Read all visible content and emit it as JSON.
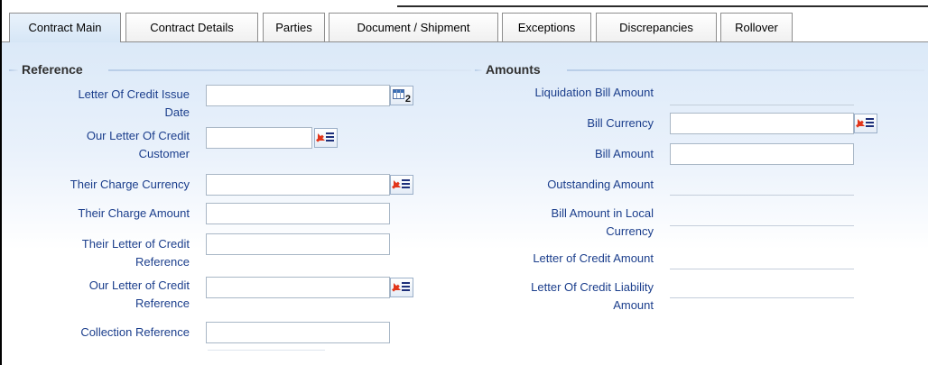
{
  "tabs": [
    {
      "label": "Contract Main",
      "active": true
    },
    {
      "label": "Contract Details",
      "active": false
    },
    {
      "label": "Parties",
      "active": false
    },
    {
      "label": "Document / Shipment",
      "active": false
    },
    {
      "label": "Exceptions",
      "active": false
    },
    {
      "label": "Discrepancies",
      "active": false
    },
    {
      "label": "Rollover",
      "active": false
    }
  ],
  "reference": {
    "title": "Reference",
    "fields": {
      "lc_issue_date": {
        "label_line1": "Letter Of Credit Issue",
        "label_line2": "Date",
        "value": "",
        "icon": "calendar-icon",
        "icon_badge": "2"
      },
      "our_lc_customer": {
        "label_line1": "Our Letter Of Credit",
        "label_line2": "Customer",
        "value": "",
        "icon": "lov-list-icon"
      },
      "their_charge_currency": {
        "label": "Their Charge Currency",
        "value": "",
        "icon": "lov-list-icon"
      },
      "their_charge_amount": {
        "label": "Their Charge Amount",
        "value": ""
      },
      "their_lc_reference": {
        "label_line1": "Their Letter of Credit",
        "label_line2": "Reference",
        "value": ""
      },
      "our_lc_reference": {
        "label_line1": "Our Letter of Credit",
        "label_line2": "Reference",
        "value": "",
        "icon": "lov-list-icon"
      },
      "collection_reference": {
        "label": "Collection Reference",
        "value": ""
      }
    }
  },
  "amounts": {
    "title": "Amounts",
    "fields": {
      "liquidation_bill_amount": {
        "label": "Liquidation Bill Amount",
        "value": ""
      },
      "bill_currency": {
        "label": "Bill Currency",
        "value": "",
        "icon": "lov-list-icon"
      },
      "bill_amount": {
        "label": "Bill Amount",
        "value": ""
      },
      "outstanding_amount": {
        "label": "Outstanding Amount",
        "value": ""
      },
      "bill_amount_local": {
        "label_line1": "Bill Amount in Local",
        "label_line2": "Currency",
        "value": ""
      },
      "lc_amount": {
        "label": "Letter of Credit Amount",
        "value": ""
      },
      "lc_liability_amount": {
        "label_line1": "Letter Of Credit Liability",
        "label_line2": "Amount",
        "value": ""
      }
    }
  },
  "colors": {
    "label_text": "#1b3e8c",
    "section_title": "#313131",
    "lov_arrow": "#e2361b"
  }
}
